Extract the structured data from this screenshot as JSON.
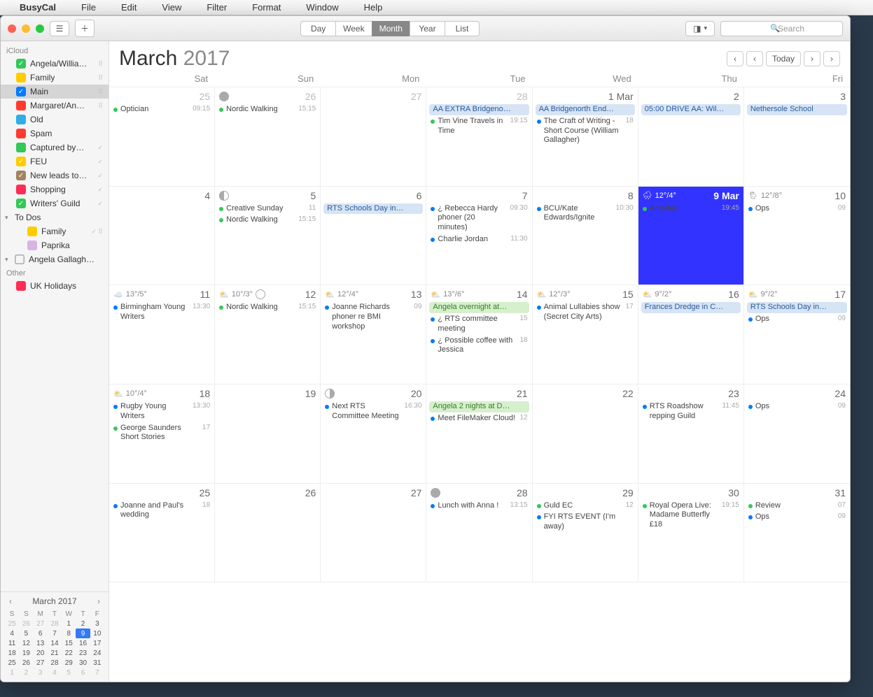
{
  "menubar": {
    "app": "BusyCal",
    "items": [
      "File",
      "Edit",
      "View",
      "Filter",
      "Format",
      "Window",
      "Help"
    ]
  },
  "toolbar": {
    "views": [
      "Day",
      "Week",
      "Month",
      "Year",
      "List"
    ],
    "active_view": "Month",
    "search_placeholder": "Search",
    "today_label": "Today"
  },
  "sidebar": {
    "sections": [
      {
        "title": "iCloud",
        "items": [
          {
            "label": "Angela/Willia…",
            "color": "#34c759",
            "checked": true,
            "shared": true
          },
          {
            "label": "Family",
            "color": "#ffcc00",
            "checked": false,
            "shared": true
          },
          {
            "label": "Main",
            "color": "#007aff",
            "checked": true,
            "selected": true,
            "shared": true
          },
          {
            "label": "Margaret/An…",
            "color": "#ff3b30",
            "checked": false,
            "shared": true
          },
          {
            "label": "Old",
            "color": "#32ade6",
            "checked": false
          },
          {
            "label": "Spam",
            "color": "#ff3b30",
            "checked": false
          },
          {
            "label": "Captured by…",
            "color": "#34c759",
            "checked": false,
            "tick": true
          },
          {
            "label": "FEU",
            "color": "#ffcc00",
            "checked": true,
            "tick": true
          },
          {
            "label": "New leads to…",
            "color": "#a2845e",
            "checked": true,
            "tick": true
          },
          {
            "label": "Shopping",
            "color": "#ff2d55",
            "checked": false,
            "tick": true
          },
          {
            "label": "Writers' Guild",
            "color": "#34c759",
            "checked": true,
            "tick": true
          }
        ]
      },
      {
        "title": "To Dos",
        "collapsible": true,
        "indent": true,
        "items": [
          {
            "label": "Family",
            "color": "#ffcc00",
            "checked": false,
            "tick": true,
            "shared": true
          },
          {
            "label": "Paprika",
            "color": "#d8b4e2",
            "checked": false
          }
        ]
      },
      {
        "title": "Angela Gallagh…",
        "collapsible": true,
        "checkbox": true,
        "items": []
      },
      {
        "title": "Other",
        "items": [
          {
            "label": "UK Holidays",
            "color": "#ff2d55",
            "checked": false
          }
        ]
      }
    ]
  },
  "minical": {
    "title": "March 2017",
    "dow": [
      "S",
      "S",
      "M",
      "T",
      "W",
      "T",
      "F"
    ],
    "rows": [
      [
        {
          "n": 25,
          "d": 1
        },
        {
          "n": 26,
          "d": 1
        },
        {
          "n": 27,
          "d": 1
        },
        {
          "n": 28,
          "d": 1
        },
        {
          "n": 1
        },
        {
          "n": 2
        },
        {
          "n": 3
        }
      ],
      [
        {
          "n": 4
        },
        {
          "n": 5
        },
        {
          "n": 6
        },
        {
          "n": 7
        },
        {
          "n": 8
        },
        {
          "n": 9,
          "t": 1
        },
        {
          "n": 10
        }
      ],
      [
        {
          "n": 11
        },
        {
          "n": 12
        },
        {
          "n": 13
        },
        {
          "n": 14
        },
        {
          "n": 15
        },
        {
          "n": 16
        },
        {
          "n": 17
        }
      ],
      [
        {
          "n": 18
        },
        {
          "n": 19
        },
        {
          "n": 20
        },
        {
          "n": 21
        },
        {
          "n": 22
        },
        {
          "n": 23
        },
        {
          "n": 24
        }
      ],
      [
        {
          "n": 25
        },
        {
          "n": 26
        },
        {
          "n": 27
        },
        {
          "n": 28
        },
        {
          "n": 29
        },
        {
          "n": 30
        },
        {
          "n": 31
        }
      ],
      [
        {
          "n": 1,
          "d": 1
        },
        {
          "n": 2,
          "d": 1
        },
        {
          "n": 3,
          "d": 1
        },
        {
          "n": 4,
          "d": 1
        },
        {
          "n": 5,
          "d": 1
        },
        {
          "n": 6,
          "d": 1
        },
        {
          "n": 7,
          "d": 1
        }
      ]
    ]
  },
  "month": {
    "title_month": "March",
    "title_year": "2017",
    "dow": [
      "Sat",
      "Sun",
      "Mon",
      "Tue",
      "Wed",
      "Thu",
      "Fri"
    ],
    "cells": [
      {
        "num": "25",
        "dim": true,
        "events": [
          {
            "dot": "#34c759",
            "txt": "Optician",
            "time": "09:15"
          }
        ]
      },
      {
        "num": "26",
        "dim": true,
        "moon": "new",
        "events": [
          {
            "dot": "#34c759",
            "txt": "Nordic Walking",
            "time": "15:15"
          }
        ]
      },
      {
        "num": "27",
        "dim": true,
        "events": []
      },
      {
        "num": "28",
        "dim": true,
        "events": [
          {
            "pill": "blue",
            "txt": "AA EXTRA Bridgeno…"
          },
          {
            "dot": "#34c759",
            "txt": "Tim Vine Travels in Time",
            "time": "19:15"
          }
        ]
      },
      {
        "num": "1 Mar",
        "events": [
          {
            "pill": "blue",
            "txt": "AA Bridgenorth End…"
          },
          {
            "dot": "#007aff",
            "txt": "The Craft of Writing - Short Course (William Gallagher)",
            "time": "18"
          }
        ]
      },
      {
        "num": "2",
        "events": [
          {
            "pill": "blue",
            "txt": "05:00 DRIVE AA: Wil…"
          }
        ]
      },
      {
        "num": "3",
        "events": [
          {
            "pill": "blue",
            "txt": "Nethersole School"
          }
        ]
      },
      {
        "num": "4",
        "events": []
      },
      {
        "num": "5",
        "moon": "q1",
        "events": [
          {
            "dot": "#34c759",
            "txt": "Creative Sunday",
            "time": "11"
          },
          {
            "dot": "#34c759",
            "txt": "Nordic Walking",
            "time": "15:15"
          }
        ]
      },
      {
        "num": "6",
        "events": [
          {
            "pill": "blue",
            "txt": "RTS Schools Day in…"
          }
        ]
      },
      {
        "num": "7",
        "events": [
          {
            "dot": "#007aff",
            "txt": "¿ Rebecca Hardy phoner (20 minutes)",
            "time": "09:30"
          },
          {
            "dot": "#007aff",
            "txt": "Charlie Jordan",
            "time": "11:30"
          }
        ]
      },
      {
        "num": "8",
        "events": [
          {
            "dot": "#007aff",
            "txt": "BCU/Kate Edwards/Ignite",
            "time": "10:30"
          }
        ]
      },
      {
        "num": "9 Mar",
        "today": true,
        "weather": "🌧",
        "temp": "12°/4°",
        "events": [
          {
            "dot": "#34c759",
            "txt": "Amedee",
            "time": "19:45"
          }
        ]
      },
      {
        "num": "10",
        "weather": "🌦",
        "temp": "12°/8°",
        "events": [
          {
            "dot": "#007aff",
            "txt": "Ops",
            "time": "09"
          }
        ]
      },
      {
        "num": "11",
        "weather": "☁️",
        "temp": "13°/5°",
        "events": [
          {
            "dot": "#007aff",
            "txt": "Birmingham Young Writers",
            "time": "13:30"
          }
        ]
      },
      {
        "num": "12",
        "weather": "⛅",
        "temp": "10°/3°",
        "moon": "full",
        "events": [
          {
            "dot": "#34c759",
            "txt": "Nordic Walking",
            "time": "15:15"
          }
        ]
      },
      {
        "num": "13",
        "weather": "⛅",
        "temp": "12°/4°",
        "events": [
          {
            "dot": "#007aff",
            "txt": "Joanne Richards phoner re BMI workshop",
            "time": "09"
          }
        ]
      },
      {
        "num": "14",
        "weather": "⛅",
        "temp": "13°/6°",
        "events": [
          {
            "pill": "green",
            "txt": "Angela overnight at…"
          },
          {
            "dot": "#007aff",
            "txt": "¿ RTS committee meeting",
            "time": "15"
          },
          {
            "dot": "#007aff",
            "txt": "¿ Possible coffee with Jessica",
            "time": "18"
          }
        ]
      },
      {
        "num": "15",
        "weather": "⛅",
        "temp": "12°/3°",
        "events": [
          {
            "dot": "#007aff",
            "txt": "Animal Lullabies show (Secret City Arts)",
            "time": "17"
          }
        ]
      },
      {
        "num": "16",
        "weather": "⛅",
        "temp": "9°/2°",
        "events": [
          {
            "pill": "blue",
            "txt": "Frances Dredge in C…"
          }
        ]
      },
      {
        "num": "17",
        "weather": "⛅",
        "temp": "9°/2°",
        "events": [
          {
            "pill": "blue",
            "txt": "RTS Schools Day in…"
          },
          {
            "dot": "#007aff",
            "txt": "Ops",
            "time": "09"
          }
        ]
      },
      {
        "num": "18",
        "weather": "⛅",
        "temp": "10°/4°",
        "events": [
          {
            "dot": "#007aff",
            "txt": "Rugby Young Writers",
            "time": "13:30"
          },
          {
            "dot": "#34c759",
            "txt": "George Saunders Short Stories",
            "time": "17"
          }
        ]
      },
      {
        "num": "19",
        "events": []
      },
      {
        "num": "20",
        "moon": "q3",
        "events": [
          {
            "dot": "#007aff",
            "txt": "Next RTS Committee Meeting",
            "time": "16:30"
          }
        ]
      },
      {
        "num": "21",
        "events": [
          {
            "pill": "green",
            "txt": "Angela 2 nights at D…"
          },
          {
            "dot": "#007aff",
            "txt": "Meet FileMaker Cloud!",
            "time": "12"
          }
        ]
      },
      {
        "num": "22",
        "events": []
      },
      {
        "num": "23",
        "events": [
          {
            "dot": "#007aff",
            "txt": "RTS Roadshow repping Guild",
            "time": "11:45"
          }
        ]
      },
      {
        "num": "24",
        "events": [
          {
            "dot": "#007aff",
            "txt": "Ops",
            "time": "09"
          }
        ]
      },
      {
        "num": "25",
        "events": [
          {
            "dot": "#007aff",
            "txt": "Joanne and Paul's wedding",
            "time": "18"
          }
        ]
      },
      {
        "num": "26",
        "events": []
      },
      {
        "num": "27",
        "events": []
      },
      {
        "num": "28",
        "moon": "new",
        "events": [
          {
            "dot": "#007aff",
            "txt": "Lunch with Anna !",
            "time": "13:15"
          }
        ]
      },
      {
        "num": "29",
        "events": [
          {
            "dot": "#34c759",
            "txt": "Guld EC",
            "time": "12"
          },
          {
            "dot": "#007aff",
            "txt": "FYI RTS EVENT (I'm away)"
          }
        ]
      },
      {
        "num": "30",
        "events": [
          {
            "dot": "#34c759",
            "txt": "Royal Opera Live: Madame Butterfly £18",
            "time": "19:15"
          }
        ]
      },
      {
        "num": "31",
        "events": [
          {
            "dot": "#34c759",
            "txt": "Review",
            "time": "07"
          },
          {
            "dot": "#007aff",
            "txt": "Ops",
            "time": "09"
          }
        ]
      }
    ]
  }
}
